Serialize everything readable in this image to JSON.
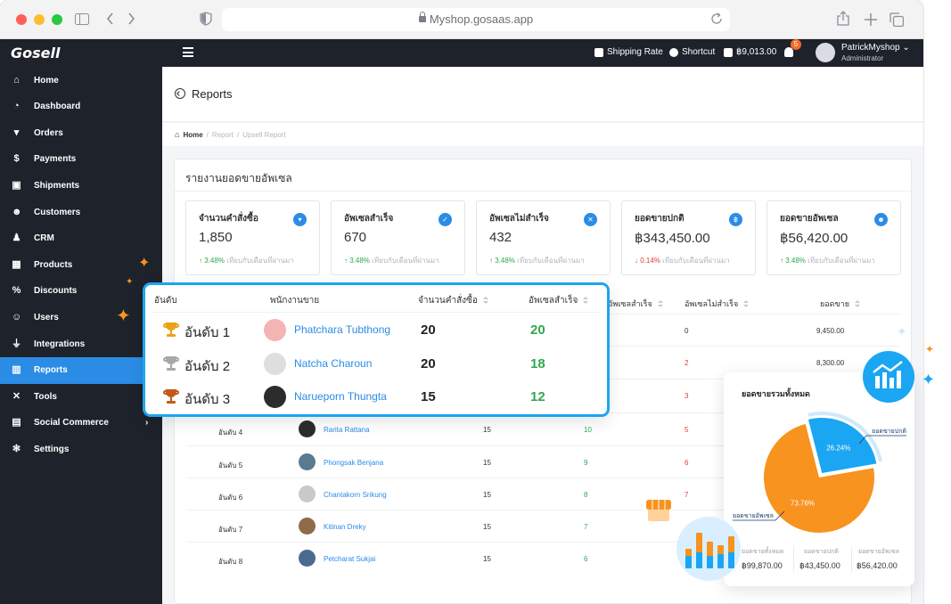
{
  "browser": {
    "url": "Myshop.gosaas.app"
  },
  "topbar": {
    "logo": "Gosell",
    "shipping_rate": "Shipping Rate",
    "shortcut": "Shortcut",
    "balance": "฿9,013.00",
    "notification_count": "5",
    "user_name": "PatrickMyshop",
    "user_role": "Administrator"
  },
  "sidebar": {
    "items": [
      {
        "label": "Home",
        "icon": "home-icon"
      },
      {
        "label": "Dashboard",
        "icon": "dashboard-icon"
      },
      {
        "label": "Orders",
        "icon": "cart-icon"
      },
      {
        "label": "Payments",
        "icon": "dollar-icon"
      },
      {
        "label": "Shipments",
        "icon": "truck-icon"
      },
      {
        "label": "Customers",
        "icon": "customers-icon"
      },
      {
        "label": "CRM",
        "icon": "crm-icon"
      },
      {
        "label": "Products",
        "icon": "products-icon"
      },
      {
        "label": "Discounts",
        "icon": "percent-icon"
      },
      {
        "label": "Users",
        "icon": "users-icon"
      },
      {
        "label": "Integrations",
        "icon": "plug-icon"
      },
      {
        "label": "Reports",
        "icon": "reports-icon"
      },
      {
        "label": "Tools",
        "icon": "tools-icon"
      },
      {
        "label": "Social Commerce",
        "icon": "social-icon"
      },
      {
        "label": "Settings",
        "icon": "gear-icon"
      }
    ],
    "active": "Reports"
  },
  "page": {
    "title": "Reports",
    "breadcrumb": [
      "Home",
      "Report",
      "Upsell Report"
    ],
    "card_title": "รายงานยอดขายอัพเซล"
  },
  "stats": [
    {
      "label": "จำนวนคำสั่งซื้อ",
      "value": "1,850",
      "change": "3.48%",
      "direction": "up",
      "note": "เทียบกับเดือนที่ผ่านมา"
    },
    {
      "label": "อัพเซลสำเร็จ",
      "value": "670",
      "change": "3.48%",
      "direction": "up",
      "note": "เทียบกับเดือนที่ผ่านมา"
    },
    {
      "label": "อัพเซลไม่สำเร็จ",
      "value": "432",
      "change": "3.48%",
      "direction": "up",
      "note": "เทียบกับเดือนที่ผ่านมา"
    },
    {
      "label": "ยอดขายปกติ",
      "value": "฿343,450.00",
      "change": "0.14%",
      "direction": "down",
      "note": "เทียบกับเดือนที่ผ่านมา"
    },
    {
      "label": "ยอดขายอัพเซล",
      "value": "฿56,420.00",
      "change": "3.48%",
      "direction": "up",
      "note": "เทียบกับเดือนที่ผ่านมา"
    }
  ],
  "table": {
    "headers": {
      "rank": "อันดับ",
      "staff": "พนักงานขาย",
      "orders": "จำนวนคำสั่งซื้อ",
      "success": "อัพเซลสำเร็จ",
      "fail": "อัพเซลไม่สำเร็จ",
      "sales": "ยอดขาย"
    },
    "rows": [
      {
        "rank": "",
        "name": "",
        "orders": "",
        "success": "",
        "fail": "0",
        "sales": "9,450.00"
      },
      {
        "rank": "",
        "name": "",
        "orders": "",
        "success": "",
        "fail": "2",
        "sales": "8,300.00"
      },
      {
        "rank": "",
        "name": "",
        "orders": "",
        "success": "",
        "fail": "3",
        "sales": ""
      },
      {
        "rank": "อันดับ 4",
        "name": "Rarita Rattana",
        "orders": "15",
        "success": "10",
        "fail": "5",
        "sales": ""
      },
      {
        "rank": "อันดับ 5",
        "name": "Phongsak Benjana",
        "orders": "15",
        "success": "9",
        "fail": "6",
        "sales": ""
      },
      {
        "rank": "อันดับ 6",
        "name": "Chantakorn Srikung",
        "orders": "15",
        "success": "8",
        "fail": "7",
        "sales": ""
      },
      {
        "rank": "อันดับ 7",
        "name": "Kitinan Dreky",
        "orders": "15",
        "success": "7",
        "fail": "",
        "sales": ""
      },
      {
        "rank": "อันดับ 8",
        "name": "Petcharat Sukjai",
        "orders": "15",
        "success": "6",
        "fail": "",
        "sales": ""
      }
    ]
  },
  "top3": {
    "headers": {
      "rank": "อันดับ",
      "staff": "พนักงานขาย",
      "orders": "จำนวนคำสั่งซื้อ",
      "success": "อัพเซลสำเร็จ"
    },
    "rows": [
      {
        "rank": "อันดับ 1",
        "name": "Phatchara Tubthong",
        "orders": "20",
        "success": "20",
        "trophy": "gold"
      },
      {
        "rank": "อันดับ 2",
        "name": "Natcha Charoun",
        "orders": "20",
        "success": "18",
        "trophy": "silver"
      },
      {
        "rank": "อันดับ 3",
        "name": "Narueporn Thungta",
        "orders": "15",
        "success": "12",
        "trophy": "bronze"
      }
    ]
  },
  "donut": {
    "title": "ยอดขายรวมทั้งหมด",
    "label_normal": "ยอดขายปกติ",
    "label_upsell": "ยอดขายอัพเซล",
    "footer": [
      {
        "label": "ยอดขายทั้งหมด",
        "value": "฿99,870.00"
      },
      {
        "label": "ยอดขายปกติ",
        "value": "฿43,450.00"
      },
      {
        "label": "ยอดขายอัพเซล",
        "value": "฿56,420.00"
      }
    ]
  },
  "chart_data": {
    "type": "pie",
    "title": "ยอดขายรวมทั้งหมด",
    "slices": [
      {
        "label": "ยอดขายอัพเซล",
        "value": 73.76,
        "text": "73.76%",
        "color": "#f7931e"
      },
      {
        "label": "ยอดขายปกติ",
        "value": 26.24,
        "text": "26.24%",
        "color": "#1aa6f2"
      }
    ]
  },
  "colors": {
    "accent": "#2b8ce6",
    "popup_border": "#1aa6f2",
    "success": "#2ea84f",
    "danger": "#e03a3a",
    "orange": "#f7931e",
    "sidebar": "#1e222b"
  }
}
